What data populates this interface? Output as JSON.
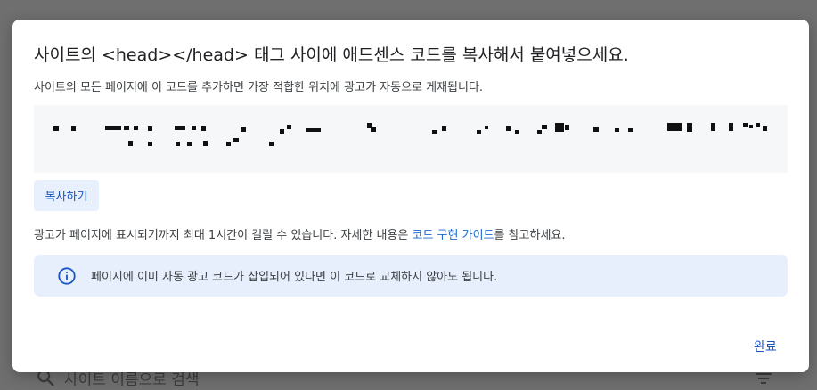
{
  "background": {
    "search_placeholder": "사이트 이름으로 검색"
  },
  "dialog": {
    "title": "사이트의 <head></head> 태그 사이에 애드센스 코드를 복사해서 붙여넣으세요.",
    "description": "사이트의 모든 페이지에 이 코드를 추가하면 가장 적합한 위치에 광고가 자동으로 게재됩니다.",
    "copy_button": "복사하기",
    "note_prefix": "광고가 페이지에 표시되기까지 최대 1시간이 걸릴 수 있습니다. 자세한 내용은 ",
    "note_link": "코드 구현 가이드",
    "note_suffix": "를 참고하세요.",
    "info_text": "페이지에 이미 자동 광고 코드가 삽입되어 있다면 이 코드로 교체하지 않아도 됩니다.",
    "done_button": "완료"
  },
  "colors": {
    "accent": "#1a56c2",
    "info_background": "#e8effc",
    "code_background": "#f6f7f9"
  },
  "icons": {
    "info": "info-circle-icon",
    "search": "search-icon",
    "filter": "filter-icon"
  }
}
